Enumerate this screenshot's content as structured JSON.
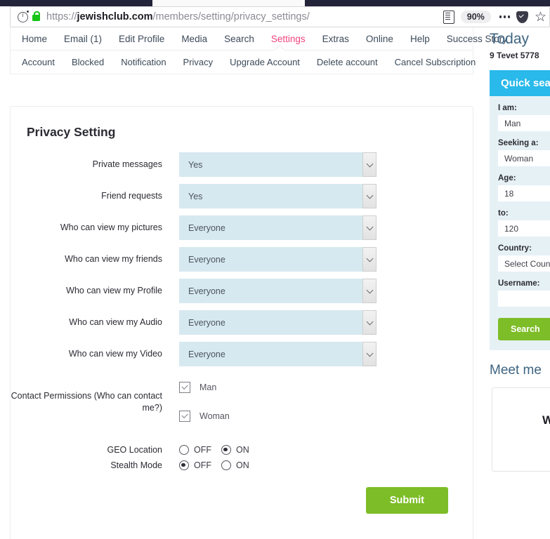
{
  "browser": {
    "url_prefix": "https://",
    "url_domain": "jewishclub.com",
    "url_path": "/members/setting/privacy_settings/",
    "zoom_level": "90%",
    "icons": {
      "info": "info-icon",
      "lock": "lock-icon",
      "reader": "reader-view-icon",
      "menu": "menu-dots-icon",
      "shield": "shield-icon",
      "bookmark": "star-icon"
    },
    "star_glyph": "☆"
  },
  "nav": {
    "main": [
      {
        "label": "Home",
        "active": false
      },
      {
        "label": "Email (1)",
        "active": false
      },
      {
        "label": "Edit Profile",
        "active": false
      },
      {
        "label": "Media",
        "active": false
      },
      {
        "label": "Search",
        "active": false
      },
      {
        "label": "Settings",
        "active": true
      },
      {
        "label": "Extras",
        "active": false
      },
      {
        "label": "Online",
        "active": false
      },
      {
        "label": "Help",
        "active": false
      },
      {
        "label": "Success Story",
        "active": false
      }
    ],
    "sub": [
      {
        "label": "Account",
        "active": false
      },
      {
        "label": "Blocked",
        "active": false
      },
      {
        "label": "Notification",
        "active": false
      },
      {
        "label": "Privacy",
        "active": true
      },
      {
        "label": "Upgrade Account",
        "active": false
      },
      {
        "label": "Delete account",
        "active": false
      },
      {
        "label": "Cancel Subscription",
        "active": false
      }
    ]
  },
  "main": {
    "title": "Privacy Setting",
    "selects": [
      {
        "label": "Private messages",
        "value": "Yes"
      },
      {
        "label": "Friend requests",
        "value": "Yes"
      },
      {
        "label": "Who can view my pictures",
        "value": "Everyone"
      },
      {
        "label": "Who can view my friends",
        "value": "Everyone"
      },
      {
        "label": "Who can view my Profile",
        "value": "Everyone"
      },
      {
        "label": "Who can view my Audio",
        "value": "Everyone"
      },
      {
        "label": "Who can view my Video",
        "value": "Everyone"
      }
    ],
    "contact_permissions": {
      "label": "Contact Permissions (Who can contact me?)",
      "options": [
        {
          "label": "Man",
          "checked": true
        },
        {
          "label": "Woman",
          "checked": true
        }
      ]
    },
    "toggles": [
      {
        "label": "GEO Location",
        "off_label": "OFF",
        "on_label": "ON",
        "selected": "ON"
      },
      {
        "label": "Stealth Mode",
        "off_label": "OFF",
        "on_label": "ON",
        "selected": "OFF"
      }
    ],
    "submit_label": "Submit"
  },
  "sidebar": {
    "today_title": "Today",
    "today_date": "9 Tevet 5778",
    "quick_search": {
      "header": "Quick search",
      "fields": [
        {
          "label": "I am:",
          "value": "Man"
        },
        {
          "label": "Seeking a:",
          "value": "Woman"
        },
        {
          "label": "Age:",
          "value": "18"
        },
        {
          "label": "to:",
          "value": "120"
        },
        {
          "label": "Country:",
          "value": "Select Country"
        },
        {
          "label": "Username:",
          "value": ""
        }
      ],
      "search_label": "Search"
    },
    "meet_me_title": "Meet me",
    "meet_me_card_text": "W"
  },
  "colors": {
    "accent_pink": "#f0447f",
    "accent_cyan": "#29b9ea",
    "accent_green": "#7dbd27",
    "select_blue": "#d7e9f0",
    "heading_blue": "#3e6480"
  }
}
